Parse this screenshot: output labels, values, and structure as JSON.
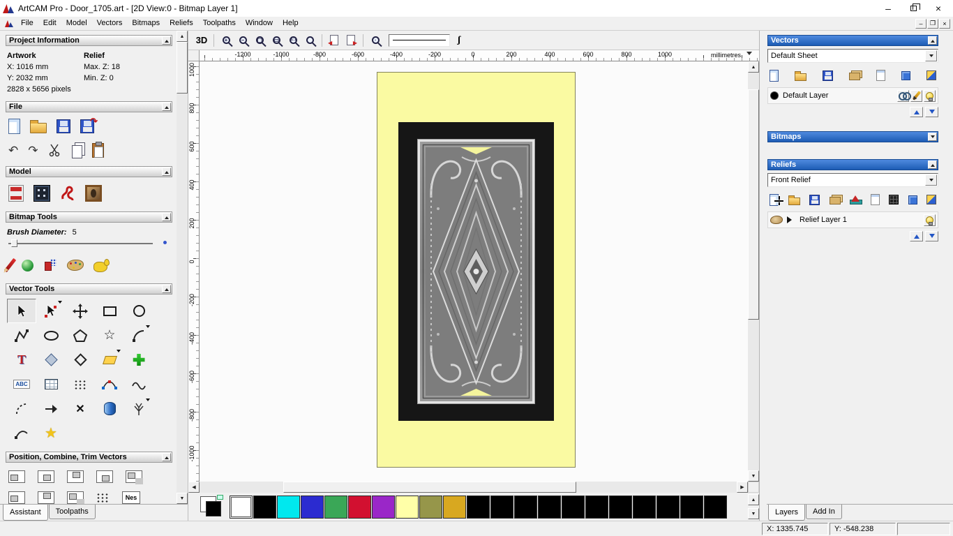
{
  "window": {
    "title": "ArtCAM Pro - Door_1705.art - [2D View:0 - Bitmap Layer 1]"
  },
  "menu": {
    "items": [
      "File",
      "Edit",
      "Model",
      "Vectors",
      "Bitmaps",
      "Reliefs",
      "Toolpaths",
      "Window",
      "Help"
    ]
  },
  "assistant": {
    "project_information": {
      "title": "Project Information",
      "artwork_header": "Artwork",
      "relief_header": "Relief",
      "artwork_x": "X: 1016 mm",
      "artwork_y": "Y: 2032 mm",
      "relief_max_z": "Max. Z: 18",
      "relief_min_z": "Min. Z: 0",
      "pixels": "2828 x 5656 pixels"
    },
    "file": {
      "title": "File",
      "icons": [
        "new-file",
        "open-file",
        "save-file",
        "import-model",
        "undo",
        "redo",
        "cut",
        "copy",
        "paste"
      ]
    },
    "model": {
      "title": "Model",
      "icons": [
        "set-model-size",
        "greyscale-view",
        "sculpt",
        "load-bitmap-painting"
      ]
    },
    "bitmap_tools": {
      "title": "Bitmap Tools",
      "brush_diameter_label": "Brush Diameter:",
      "brush_diameter_value": "5",
      "icons": [
        "pencil",
        "sphere-paint",
        "spray",
        "palette",
        "flood-fill"
      ]
    },
    "vector_tools": {
      "title": "Vector Tools",
      "abc_icon_label": "ABC",
      "icons": [
        "select",
        "node-editing",
        "transform",
        "create-rectangle",
        "create-circle",
        "create-polyline",
        "create-ellipse",
        "create-polygon",
        "create-star",
        "create-arc",
        "create-text",
        "mirror",
        "fillet",
        "offset",
        "block-copy",
        "text-in-box",
        "grid",
        "dot-array",
        "bezier-edit",
        "smooth-wave",
        "dashed-arc",
        "direction",
        "trim",
        "extrude",
        "distort-tree",
        "close-curve",
        "star-wizard"
      ]
    },
    "position_combine": {
      "title": "Position, Combine, Trim Vectors",
      "nesting_icon_label": "Nes",
      "icons": [
        "align-left",
        "align-center",
        "align-top",
        "align-bottom",
        "center-in-page",
        "align-h",
        "align-v",
        "align-grid",
        "scatter",
        "nesting"
      ]
    },
    "tabs": [
      "Assistant",
      "Toolpaths"
    ]
  },
  "view": {
    "toolbar_3d_label": "3D",
    "toolbar_icons": [
      "3d-view",
      "zoom-in",
      "zoom-out",
      "zoom-fit",
      "zoom-rect",
      "zoom-1to1",
      "zoom-object",
      "previous-bitmap",
      "next-bitmap",
      "zoom-selection",
      "line-style",
      "freehand-pen"
    ],
    "ruler_unit": "millimetres",
    "ruler_horizontal": [
      "-1200",
      "-1000",
      "-800",
      "-600",
      "-400",
      "-200",
      "0",
      "200",
      "400",
      "600",
      "800",
      "1000"
    ],
    "ruler_vertical": [
      "1000",
      "800",
      "600",
      "400",
      "200",
      "0",
      "-200",
      "-400",
      "-600",
      "-800",
      "-1000"
    ]
  },
  "palette": {
    "swatches": [
      "#ffffff",
      "#000000",
      "#00e8ee",
      "#2b2bd0",
      "#3aa757",
      "#d21030",
      "#9a27c8",
      "#ffffa8",
      "#96964a",
      "#d8a820",
      "#000000",
      "#000000",
      "#000000",
      "#000000",
      "#000000",
      "#000000",
      "#000000",
      "#000000",
      "#000000",
      "#000000",
      "#000000"
    ]
  },
  "layers_panel": {
    "vectors": {
      "title": "Vectors",
      "sheet_value": "Default Sheet",
      "layer_name": "Default Layer",
      "layer_color": "#000000",
      "toolbar_icons": [
        "new-layer",
        "open-layer",
        "save-layer",
        "merge-layers",
        "new-sheet",
        "cube",
        "toggle-all"
      ]
    },
    "bitmaps": {
      "title": "Bitmaps"
    },
    "reliefs": {
      "title": "Reliefs",
      "relief_value": "Front Relief",
      "layer_name": "Relief Layer 1",
      "toolbar_icons": [
        "new-layer",
        "open-layer",
        "save-layer",
        "merge-layers",
        "calculate-relief",
        "new-sheet",
        "greyscale-preview",
        "cube",
        "toggle-all"
      ]
    },
    "tabs": [
      "Layers",
      "Add In"
    ]
  },
  "status_bar": {
    "x": "X: 1335.745",
    "y": "Y: -548.238"
  }
}
